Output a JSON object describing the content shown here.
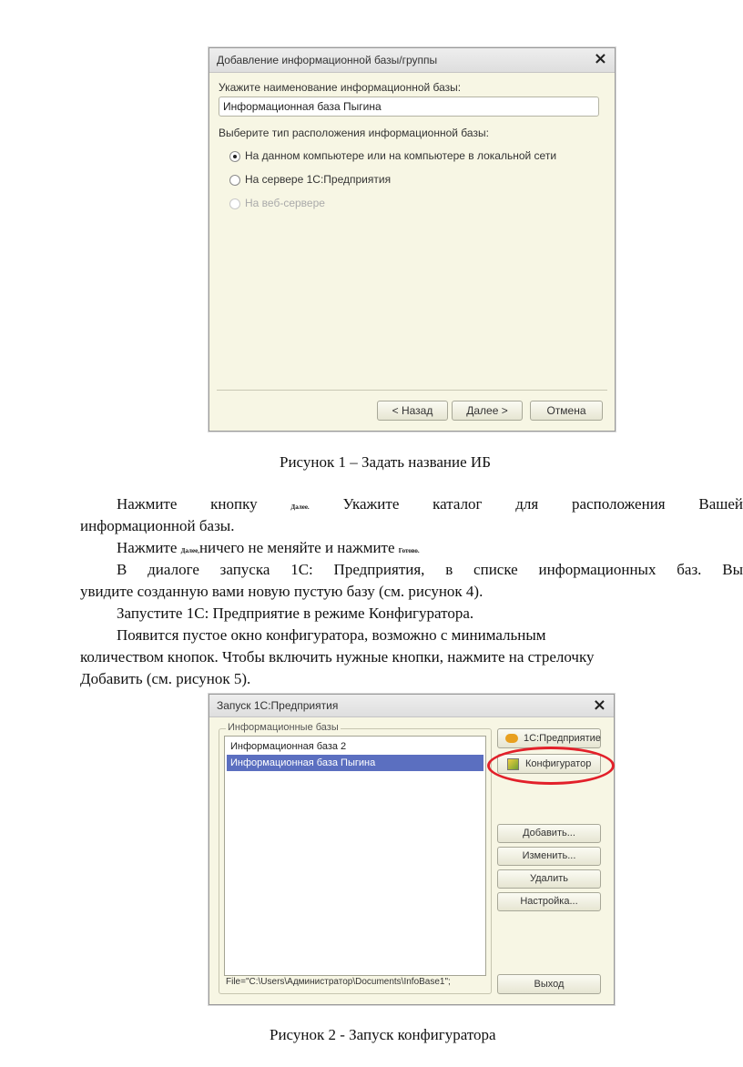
{
  "figure1": {
    "dialog": {
      "title": "Добавление информационной базы/группы",
      "name_label": "Укажите наименование информационной базы:",
      "name_value": "Информационная база Пыгина",
      "location_label": "Выберите тип расположения информационной базы:",
      "options": [
        {
          "label": "На данном компьютере или на компьютере в локальной сети",
          "selected": true,
          "enabled": true
        },
        {
          "label": "На сервере 1С:Предприятия",
          "selected": false,
          "enabled": true
        },
        {
          "label": "На веб-сервере",
          "selected": false,
          "enabled": false
        }
      ],
      "buttons": {
        "back": "< Назад",
        "next": "Далее >",
        "cancel": "Отмена"
      }
    },
    "caption": "Рисунок 1 – Задать название ИБ"
  },
  "text": {
    "p1_a": "Нажмите кнопку",
    "p1_btn": "Далее.",
    "p1_b": "Укажите каталог для расположения Вашей",
    "p1_c": "информационной базы.",
    "p2_a": "Нажмите",
    "p2_btn1": "Далее,",
    "p2_b": "ничего не меняйте и нажмите",
    "p2_btn2": "Готово.",
    "p3_line1": "В диалоге запуска 1С: Предприятия, в списке информационных баз. Вы",
    "p3_line2": "увидите созданную вами новую пустую базу (см. рисунок 4).",
    "p4": "Запустите 1С: Предприятие в режиме Конфигуратора.",
    "p5_line1": "Появится пустое окно конфигуратора, возможно с минимальным",
    "p5_line2": "количеством кнопок. Чтобы включить нужные кнопки, нажмите на стрелочку",
    "p5_line3": "Добавить (см. рисунок 5)."
  },
  "figure2": {
    "dialog": {
      "title": "Запуск 1С:Предприятия",
      "group_label": "Информационные базы",
      "items": [
        {
          "label": "Информационная база 2",
          "selected": false
        },
        {
          "label": "Информационная база Пыгина",
          "selected": true
        }
      ],
      "path": "File=\"C:\\Users\\Администратор\\Documents\\InfoBase1\";",
      "buttons": {
        "enterprise": "1С:Предприятие",
        "configurator": "Конфигуратор",
        "add": "Добавить...",
        "edit": "Изменить...",
        "delete": "Удалить",
        "settings": "Настройка...",
        "exit": "Выход"
      }
    },
    "caption": "Рисунок 2 - Запуск конфигуратора"
  },
  "colors": {
    "dialog_bg": "#f7f6e4",
    "selection": "#5b6fc0",
    "highlight": "#e2202a"
  }
}
